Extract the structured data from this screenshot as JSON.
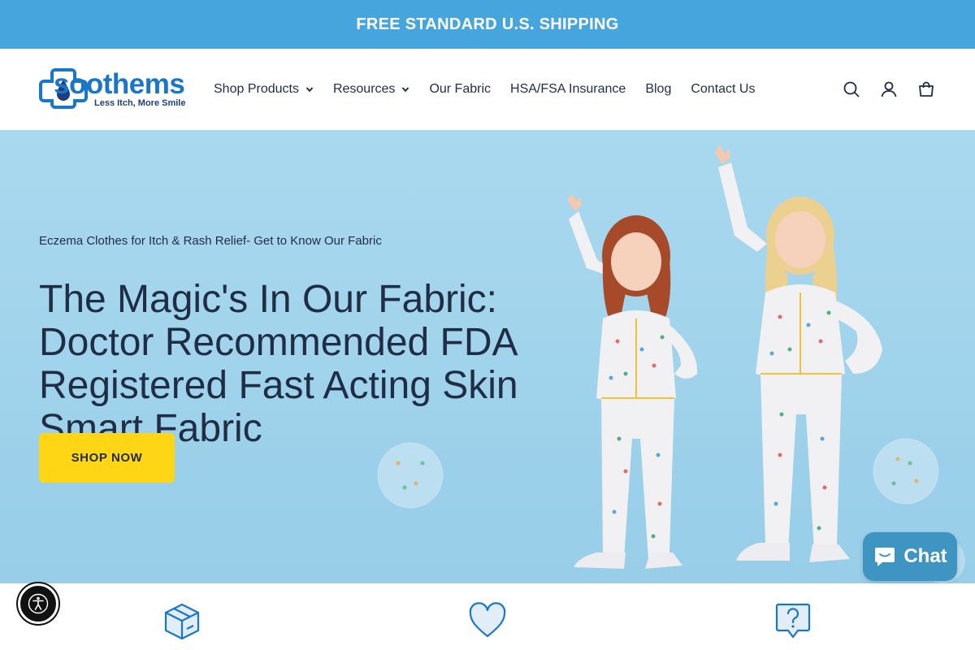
{
  "announcement": {
    "text": "FREE STANDARD U.S. SHIPPING"
  },
  "brand": {
    "name": "soothems",
    "tagline": "Less Itch, More Smile",
    "color": "#1a76c6"
  },
  "nav": {
    "items": [
      {
        "label": "Shop Products",
        "has_dropdown": true
      },
      {
        "label": "Resources",
        "has_dropdown": true
      },
      {
        "label": "Our Fabric",
        "has_dropdown": false
      },
      {
        "label": "HSA/FSA Insurance",
        "has_dropdown": false
      },
      {
        "label": "Blog",
        "has_dropdown": false
      },
      {
        "label": "Contact Us",
        "has_dropdown": false
      }
    ]
  },
  "header_icons": [
    "search-icon",
    "account-icon",
    "cart-icon"
  ],
  "hero": {
    "kicker": "Eczema Clothes for Itch & Rash Relief- Get to Know Our Fabric",
    "title": "The Magic's In Our Fabric: Doctor Recommended FDA Registered Fast Acting Skin Smart Fabric",
    "cta_label": "SHOP NOW"
  },
  "features": {
    "icons": [
      "box-icon",
      "heart-icon",
      "question-bubble-icon"
    ]
  },
  "chat": {
    "label": "Chat"
  },
  "colors": {
    "announcement_bg": "#45a5dc",
    "cta_bg": "#ffd616",
    "text_dark": "#1f2d45",
    "chat_bg": "#3f95c2"
  }
}
